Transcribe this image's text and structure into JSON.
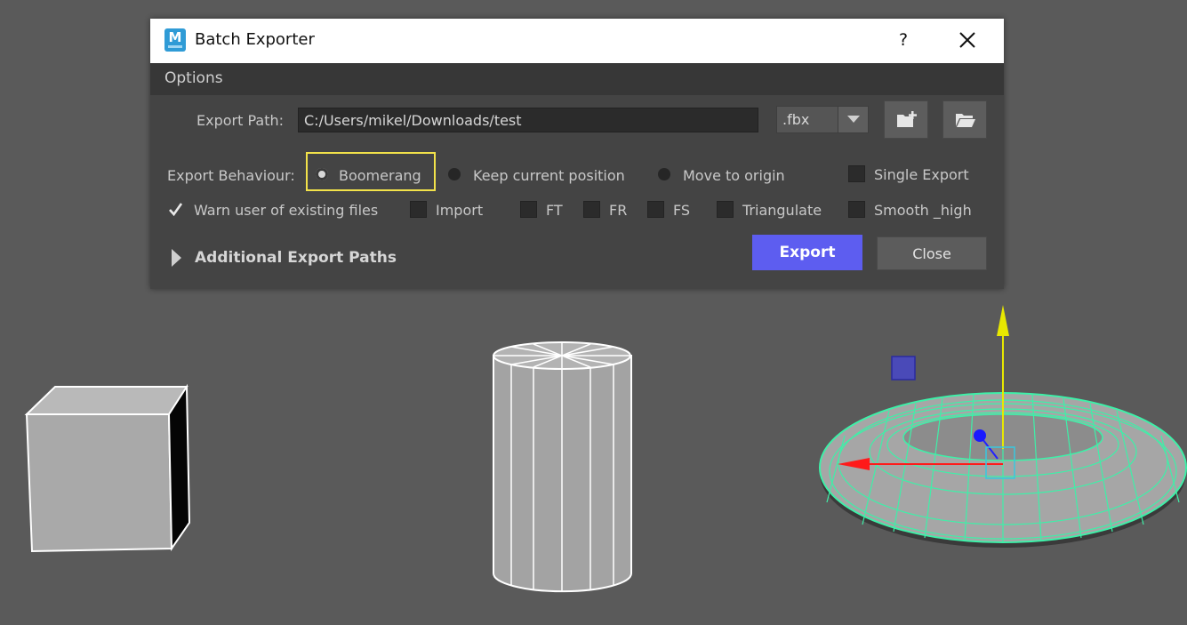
{
  "window": {
    "title": "Batch Exporter",
    "app_icon_letter": "M",
    "help_label": "?"
  },
  "menu": {
    "options_label": "Options"
  },
  "export_path": {
    "label": "Export Path:",
    "value": "C:/Users/mikel/Downloads/test",
    "format": ".fbx"
  },
  "behaviour": {
    "label": "Export Behaviour:",
    "options": [
      "Boomerang",
      "Keep current position",
      "Move to origin"
    ],
    "selected": "Boomerang",
    "single_export_label": "Single Export"
  },
  "checkboxes": {
    "warn_label": "Warn user of existing files",
    "import_label": "Import",
    "ft_label": "FT",
    "fr_label": "FR",
    "fs_label": "FS",
    "triangulate_label": "Triangulate",
    "smooth_label": "Smooth _high",
    "warn_checked": true
  },
  "additional": {
    "label": "Additional Export Paths"
  },
  "buttons": {
    "export_label": "Export",
    "close_label": "Close"
  },
  "colors": {
    "accent": "#5d5df0",
    "highlight": "#f2e24a",
    "selection_wire": "#3ef0a8",
    "viewport": "#5a5a5a"
  },
  "icons": {
    "new_folder": "folder-plus-icon",
    "open_folder": "folder-open-icon",
    "close": "close-icon",
    "expand": "triangle-right-icon"
  }
}
